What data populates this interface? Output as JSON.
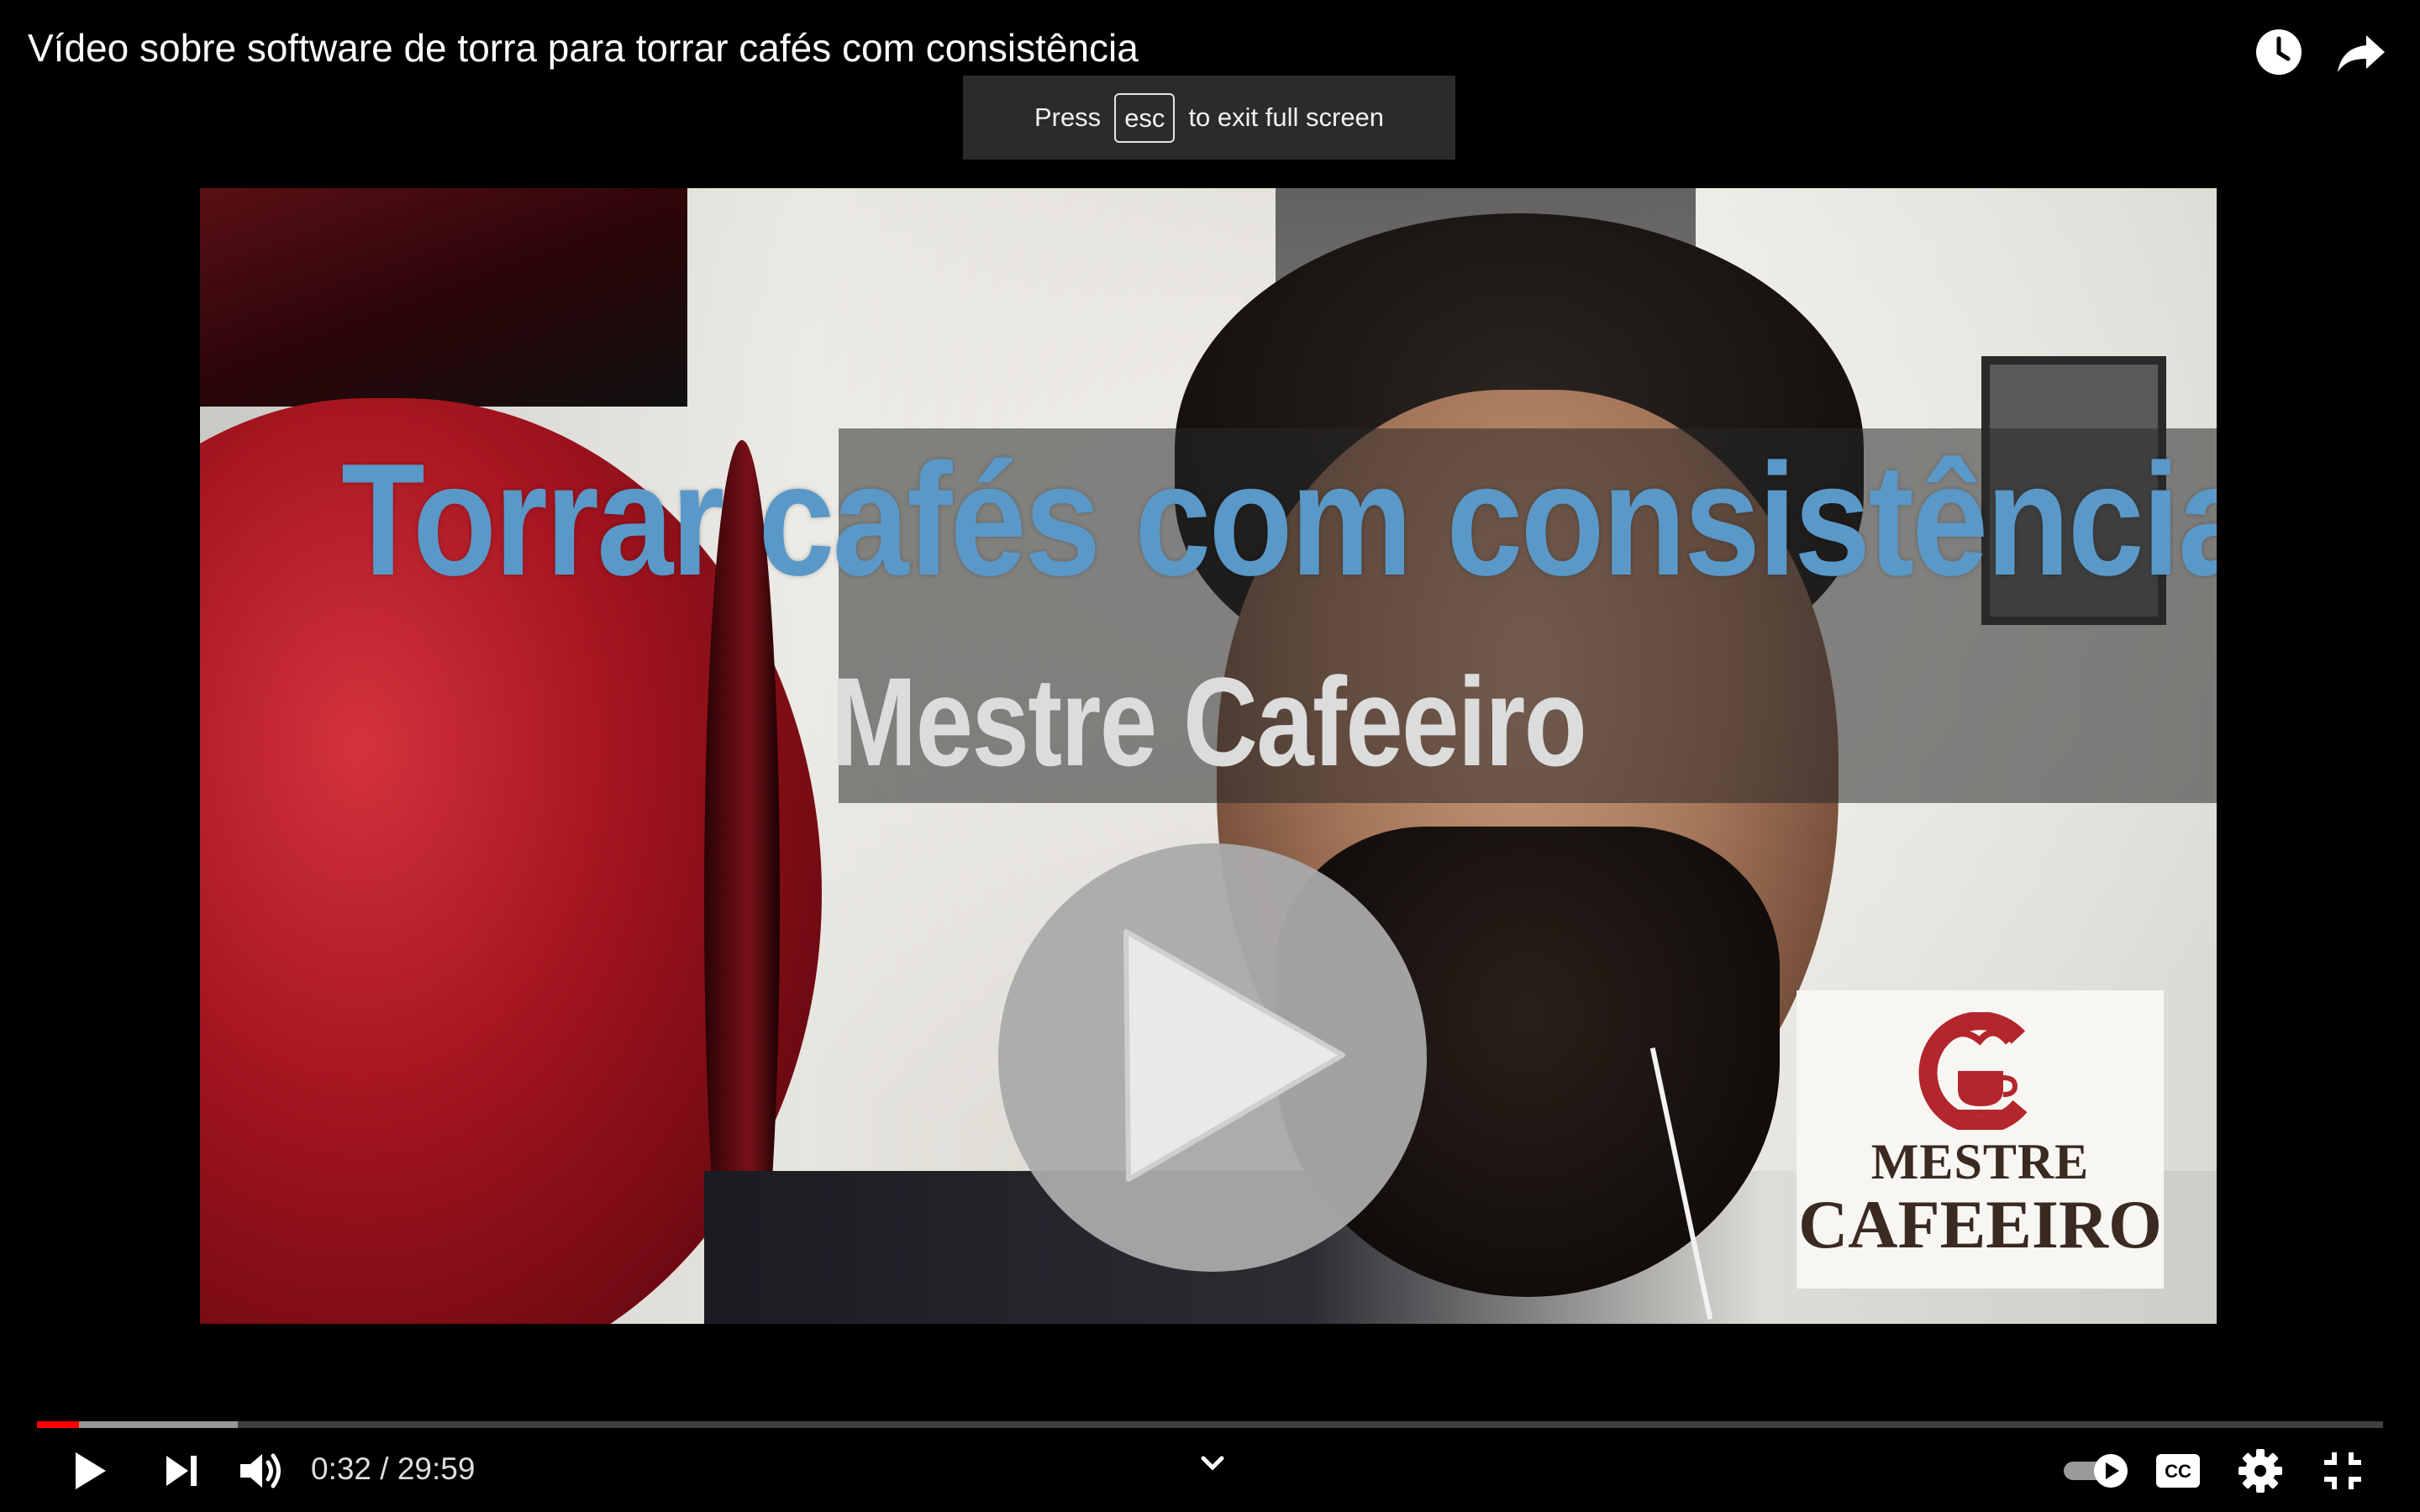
{
  "header": {
    "video_title": "Vídeo sobre software de torra para torrar cafés com consistência",
    "watch_later_icon": "clock-icon",
    "share_icon": "share-arrow-icon"
  },
  "fullscreen_notice": {
    "press": "Press",
    "key": "esc",
    "rest": "to exit full screen"
  },
  "video": {
    "overlay_title": "Torrar cafés com consistência",
    "overlay_subtitle": "Mestre Cafeeiro",
    "logo_line1": "MESTRE",
    "logo_line2": "CAFEEIRO",
    "big_play_icon": "play-icon"
  },
  "player": {
    "current_time": "0:32",
    "duration": "29:59",
    "time_text": "0:32 / 29:59",
    "played_fraction": 0.0178,
    "buffered_fraction": 0.0855,
    "autoplay": "on",
    "icons": [
      "play-icon",
      "next-icon",
      "volume-icon",
      "chevron-down-icon",
      "autoplay-toggle-icon",
      "cc-icon",
      "gear-icon",
      "exit-fullscreen-icon"
    ]
  },
  "colors": {
    "progress_played": "#ff0000",
    "overlay_title": "#5a98c8",
    "toast_bg": "#2a2b2d"
  }
}
